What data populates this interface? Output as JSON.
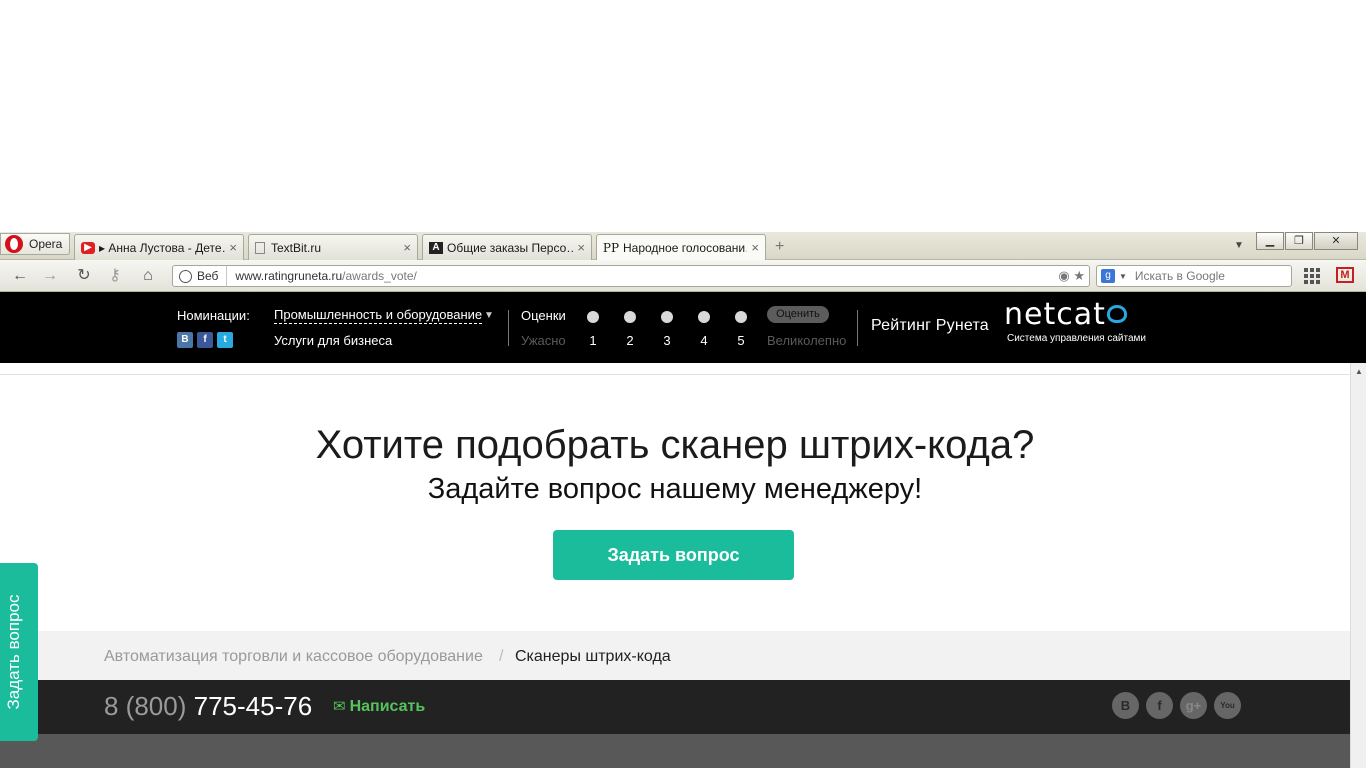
{
  "browser": {
    "opera_label": "Opera",
    "tabs": [
      {
        "title": "▸ Анна Лустова - Дете…",
        "close": "×"
      },
      {
        "title": "TextBit.ru",
        "close": "×"
      },
      {
        "title": "Общие заказы Персо…",
        "close": "×"
      },
      {
        "title": "Народное голосовани…",
        "close": "×"
      }
    ],
    "new_tab": "+",
    "address": {
      "web_label": "Веб",
      "host": "www.ratingruneta.ru",
      "path": "/awards_vote/"
    },
    "search_placeholder": "Искать в Google"
  },
  "vote_bar": {
    "nominations_label": "Номинации:",
    "nomination_selected": "Промышленность и оборудование",
    "nomination_sub": "Услуги для бизнеса",
    "ratings_label": "Оценки",
    "rating_low": "Ужасно",
    "rating_high": "Великолепно",
    "rating_values": [
      "1",
      "2",
      "3",
      "4",
      "5"
    ],
    "rate_button": "Оценить",
    "runet_label": "Рейтинг Рунета",
    "netcat_logo": "netcat",
    "netcat_sub": "Система управления сайтами",
    "social": [
      "В",
      "f",
      "t"
    ]
  },
  "main": {
    "headline": "Хотите подобрать сканер штрих-кода?",
    "subheadline": "Задайте вопрос нашему менеджеру!",
    "ask_button": "Задать вопрос",
    "side_tab": "Задать вопрос"
  },
  "breadcrumb": {
    "parent": "Автоматизация торговли и кассовое оборудование",
    "separator": "/",
    "current": "Сканеры штрих-кода"
  },
  "footer": {
    "phone_code": "8 (800)",
    "phone_number": "775-45-76",
    "write_label": "Написать",
    "social": [
      "B",
      "f",
      "g+",
      "You"
    ]
  },
  "colors": {
    "accent": "#1abc9c",
    "write_green": "#55c25c",
    "netcat_blue": "#29a8e0"
  }
}
